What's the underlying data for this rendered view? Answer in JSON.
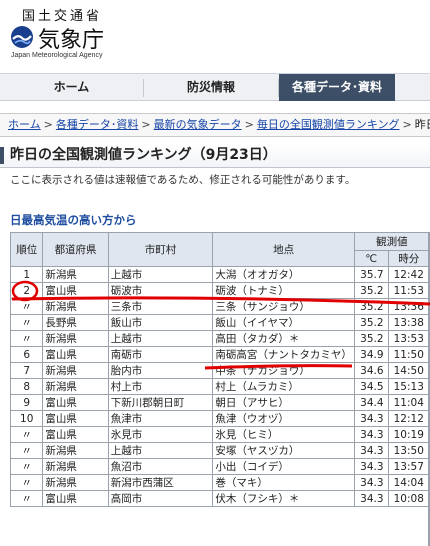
{
  "header": {
    "ministry": "国土交通省",
    "agency": "気象庁",
    "agency_en": "Japan Meteorological Agency",
    "logo_icon": "jma-logo-icon"
  },
  "nav": {
    "items": [
      {
        "label": "ホーム",
        "active": false
      },
      {
        "label": "防災情報",
        "active": false
      },
      {
        "label": "各種データ･資料",
        "active": true
      }
    ]
  },
  "breadcrumb": {
    "items": [
      "ホーム",
      "各種データ･資料",
      "最新の気象データ",
      "毎日の全国観測値ランキング",
      "昨日の"
    ],
    "separator": ">"
  },
  "page": {
    "title": "昨日の全国観測値ランキング（9月23日）",
    "notice": "ここに表示される値は速報値であるため、修正される可能性があります。",
    "section": "日最高気温の高い方から"
  },
  "table": {
    "headers": {
      "rank": "順位",
      "pref": "都道府県",
      "city": "市町村",
      "station": "地点",
      "obs": "観測値",
      "unit": "℃",
      "time": "時分"
    },
    "rows": [
      {
        "rank": "1",
        "pref": "新潟県",
        "city": "上越市",
        "station": "大潟（オオガタ）",
        "value": "35.7",
        "time": "12:42"
      },
      {
        "rank": "2",
        "pref": "富山県",
        "city": "砺波市",
        "station": "砺波（トナミ）",
        "value": "35.2",
        "time": "11:53"
      },
      {
        "rank": "〃",
        "pref": "新潟県",
        "city": "三条市",
        "station": "三条（サンジョウ）",
        "value": "35.2",
        "time": "13:36"
      },
      {
        "rank": "〃",
        "pref": "長野県",
        "city": "飯山市",
        "station": "飯山（イイヤマ）",
        "value": "35.2",
        "time": "13:38"
      },
      {
        "rank": "〃",
        "pref": "新潟県",
        "city": "上越市",
        "station": "高田（タカダ）＊",
        "value": "35.2",
        "time": "13:53"
      },
      {
        "rank": "6",
        "pref": "富山県",
        "city": "南砺市",
        "station": "南砺高宮（ナントタカミヤ）",
        "value": "34.9",
        "time": "11:50"
      },
      {
        "rank": "7",
        "pref": "新潟県",
        "city": "胎内市",
        "station": "中条（ナカジョウ）",
        "value": "34.6",
        "time": "14:50"
      },
      {
        "rank": "8",
        "pref": "新潟県",
        "city": "村上市",
        "station": "村上（ムラカミ）",
        "value": "34.5",
        "time": "15:13"
      },
      {
        "rank": "9",
        "pref": "富山県",
        "city": "下新川郡朝日町",
        "station": "朝日（アサヒ）",
        "value": "34.4",
        "time": "11:04"
      },
      {
        "rank": "10",
        "pref": "富山県",
        "city": "魚津市",
        "station": "魚津（ウオヅ）",
        "value": "34.3",
        "time": "12:12"
      },
      {
        "rank": "〃",
        "pref": "富山県",
        "city": "氷見市",
        "station": "氷見（ヒミ）",
        "value": "34.3",
        "time": "10:19"
      },
      {
        "rank": "〃",
        "pref": "新潟県",
        "city": "上越市",
        "station": "安塚（ヤスヅカ）",
        "value": "34.3",
        "time": "13:50"
      },
      {
        "rank": "〃",
        "pref": "新潟県",
        "city": "魚沼市",
        "station": "小出（コイデ）",
        "value": "34.3",
        "time": "13:57"
      },
      {
        "rank": "〃",
        "pref": "新潟県",
        "city": "新潟市西蒲区",
        "station": "巻（マキ）",
        "value": "34.3",
        "time": "14:04"
      },
      {
        "rank": "〃",
        "pref": "富山県",
        "city": "高岡市",
        "station": "伏木（フシキ）＊",
        "value": "34.3",
        "time": "10:08"
      }
    ]
  },
  "colors": {
    "nav_active": "#3d4f67",
    "link": "#1846a8",
    "header_cell": "#dfe6f0",
    "annotation": "#e00000"
  }
}
